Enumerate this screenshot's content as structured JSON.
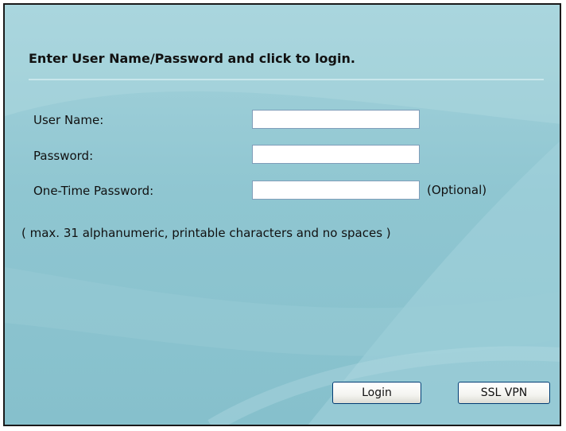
{
  "form": {
    "heading": "Enter User Name/Password and click to login.",
    "fields": [
      {
        "label": "User Name:",
        "value": ""
      },
      {
        "label": "Password:",
        "value": ""
      },
      {
        "label": "One-Time Password:",
        "value": ""
      }
    ],
    "optional_note": "(Optional)",
    "hint": "( max. 31 alphanumeric, printable characters and no spaces )"
  },
  "buttons": {
    "login_label": "Login",
    "sslvpn_label": "SSL VPN"
  },
  "colors": {
    "panel_background": "#8fc6d1",
    "panel_border": "#1a1a1a",
    "input_border": "#7f9db9",
    "button_border": "#003c74"
  }
}
